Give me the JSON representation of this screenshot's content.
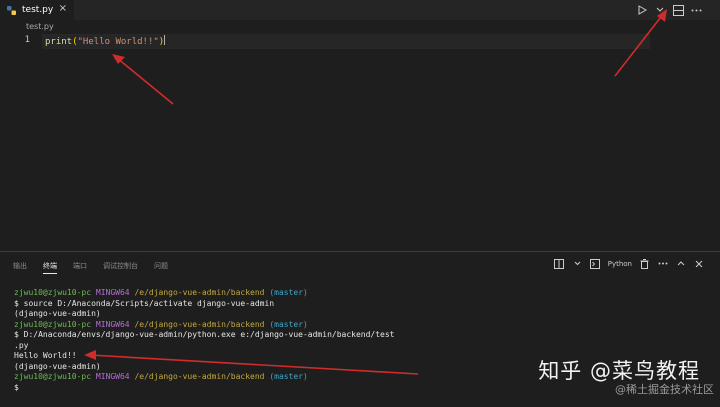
{
  "tab": {
    "filename": "test.py"
  },
  "breadcrumb": "test.py",
  "editor": {
    "line_number": "1",
    "code": {
      "fn": "print",
      "open": "(",
      "str": "\"Hello World!!\"",
      "close": ")"
    }
  },
  "panel": {
    "tabs": [
      "输出",
      "终端",
      "端口",
      "调试控制台",
      "问题"
    ],
    "active_tab": "终端",
    "shell_label": "Python"
  },
  "terminal": {
    "prompt1": {
      "user": "zjwu10@zjwu10-pc",
      "host": "MINGW64",
      "path": "/e/django-vue-admin/backend",
      "branch": "(master)"
    },
    "cmd1": "$ source D:/Anaconda/Scripts/activate django-vue-admin",
    "env1": "(django-vue-admin)",
    "prompt2": {
      "user": "zjwu10@zjwu10-pc",
      "host": "MINGW64",
      "path": "/e/django-vue-admin/backend",
      "branch": "(master)"
    },
    "cmd2": "$ D:/Anaconda/envs/django-vue-admin/python.exe e:/django-vue-admin/backend/test",
    "cmd2_cont": ".py",
    "output": "Hello World!!",
    "env2": "(django-vue-admin)",
    "prompt3": {
      "user": "zjwu10@zjwu10-pc",
      "host": "MINGW64",
      "path": "/e/django-vue-admin/backend",
      "branch": "(master)"
    },
    "cursor_line": "$"
  },
  "watermark": {
    "main": "知乎 @菜鸟教程",
    "sub": "@稀土掘金技术社区"
  },
  "colors": {
    "background": "#1e1e1e",
    "annotation_arrow": "#d22b2b"
  }
}
